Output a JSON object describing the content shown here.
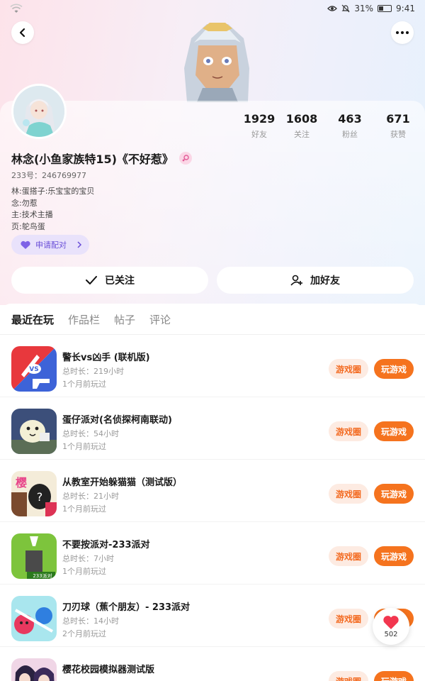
{
  "status_bar": {
    "battery": "31%",
    "time": "9:41"
  },
  "profile": {
    "name": "林念(小鱼家族特15)《不好惹》",
    "uid": "233号：246769977",
    "bio": [
      "林:蛋搭子:乐宝宝的宝贝",
      "念:勿惹",
      "主:技术主播",
      "页:鸵鸟蛋"
    ],
    "pair_label": "申请配对"
  },
  "stats": [
    {
      "value": "1929",
      "label": "好友"
    },
    {
      "value": "1608",
      "label": "关注"
    },
    {
      "value": "463",
      "label": "粉丝"
    },
    {
      "value": "671",
      "label": "获赞"
    }
  ],
  "actions": {
    "follow": "已关注",
    "add_friend": "加好友"
  },
  "tabs": [
    "最近在玩",
    "作品栏",
    "帖子",
    "评论"
  ],
  "games": [
    {
      "name": "警长vs凶手 (联机版)",
      "duration": "总时长：219小时",
      "last": "1个月前玩过",
      "circle": "游戏圈",
      "play": "玩游戏"
    },
    {
      "name": "蛋仔派对(名侦探柯南联动)",
      "duration": "总时长：54小时",
      "last": "1个月前玩过",
      "circle": "游戏圈",
      "play": "玩游戏"
    },
    {
      "name": "从教室开始躲猫猫（测试版）",
      "duration": "总时长：21小时",
      "last": "1个月前玩过",
      "circle": "游戏圈",
      "play": "玩游戏"
    },
    {
      "name": "不要按派对-233派对",
      "duration": "总时长：7小时",
      "last": "1个月前玩过",
      "circle": "游戏圈",
      "play": "玩游戏"
    },
    {
      "name": "刀刃球（蕉个朋友）- 233派对",
      "duration": "总时长：14小时",
      "last": "2个月前玩过",
      "circle": "游戏圈",
      "play": "玩游戏"
    },
    {
      "name": "樱花校园模拟器测试版",
      "duration": "",
      "last": "",
      "circle": "游戏圈",
      "play": "玩游戏"
    }
  ],
  "icon_text": {
    "vs": "VS",
    "sakura": "樱",
    "question": "?",
    "party233": "233派对"
  },
  "like": {
    "count": "502"
  },
  "colors": {
    "accent": "#f5731e",
    "accent_soft": "#fdebe2",
    "pair": "#6a4fd8"
  }
}
